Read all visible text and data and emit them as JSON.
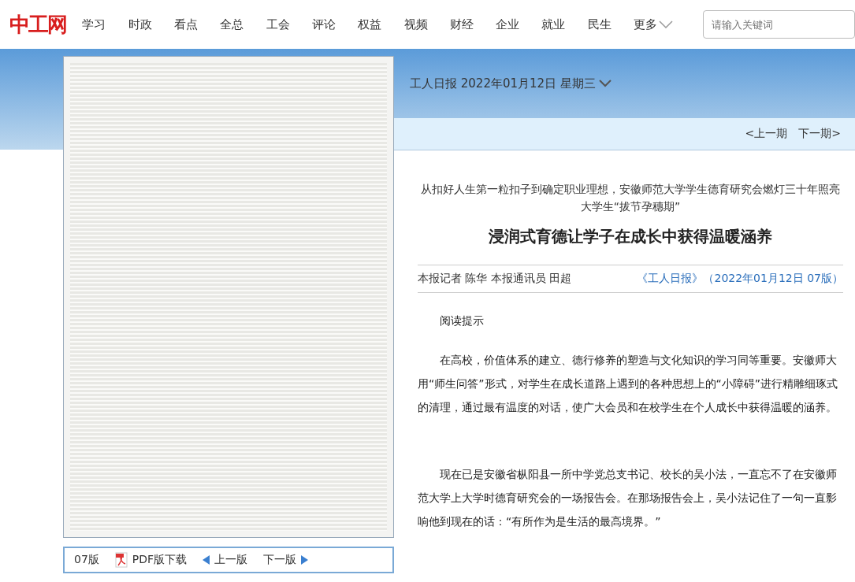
{
  "header": {
    "logo": "中工网",
    "nav": [
      "学习",
      "时政",
      "看点",
      "全总",
      "工会",
      "评论",
      "权益",
      "视频",
      "财经",
      "企业",
      "就业",
      "民生"
    ],
    "more": "更多",
    "search": {
      "placeholder": "请输入关键词"
    }
  },
  "paper": {
    "edition_date": "工人日报 2022年01月12日 星期三",
    "prev_issue": "<上一期",
    "next_issue": "下一期>"
  },
  "page_bar": {
    "page": "07版",
    "pdf": "PDF版下载",
    "prev_page": "上一版",
    "next_page": "下一版"
  },
  "article": {
    "subtitle": "从扣好人生第一粒扣子到确定职业理想，安徽师范大学学生德育研究会燃灯三十年照亮大学生“拔节孕穗期”",
    "title": "浸润式育德让学子在成长中获得温暖涵养",
    "byline": "本报记者 陈华 本报通讯员 田超",
    "source": "《工人日报》（2022年01月12日 07版）",
    "paragraphs": [
      "阅读提示",
      "在高校，价值体系的建立、德行修养的塑造与文化知识的学习同等重要。安徽师大用“师生问答”形式，对学生在成长道路上遇到的各种思想上的“小障碍”进行精雕细琢式的清理，通过最有温度的对话，使广大会员和在校学生在个人成长中获得温暖的涵养。",
      "现在已是安徽省枞阳县一所中学党总支书记、校长的吴小法，一直忘不了在安徽师范大学上大学时德育研究会的一场报告会。在那场报告会上，吴小法记住了一句一直影响他到现在的话：“有所作为是生活的最高境界。”"
    ]
  }
}
